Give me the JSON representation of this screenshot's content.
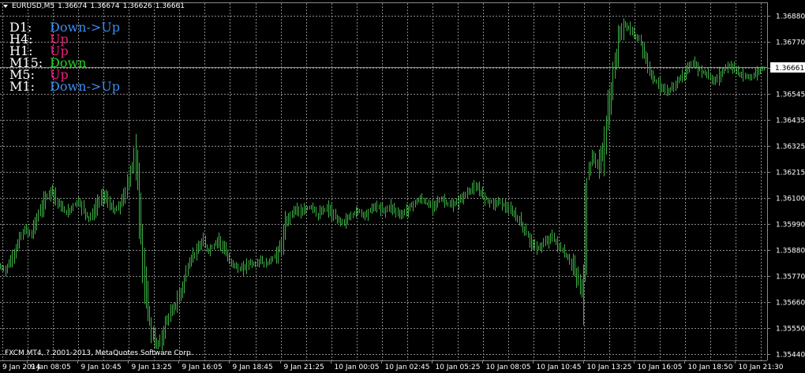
{
  "header": {
    "symbol": "EURUSD,M5",
    "ohlc": [
      "1.36674",
      "1.36674",
      "1.36626",
      "1.36661"
    ]
  },
  "indicator": {
    "rows": [
      {
        "tf": "D1:",
        "trend": "Down->Up",
        "color": "#3B8CF0"
      },
      {
        "tf": "H4:",
        "trend": "Up",
        "color": "#E8207A"
      },
      {
        "tf": "H1:",
        "trend": "Up",
        "color": "#E8207A"
      },
      {
        "tf": "M15:",
        "trend": "Down",
        "color": "#22D222"
      },
      {
        "tf": "M5:",
        "trend": "Up",
        "color": "#E8207A"
      },
      {
        "tf": "M1:",
        "trend": "Down->Up",
        "color": "#3B8CF0"
      }
    ]
  },
  "copyright": "FXCM MT4, ? 2001-2013, MetaQuotes Software Corp.",
  "colors": {
    "background": "#000000",
    "grid": "#8A8A8A",
    "bars": "#3CB043",
    "bid_line": "#7D8BA8",
    "text": "#FFFFFF"
  },
  "chart_data": {
    "type": "line",
    "price_axis_labels": [
      "1.36880",
      "1.36770",
      "1.36661",
      "1.36545",
      "1.36435",
      "1.36325",
      "1.36215",
      "1.36100",
      "1.35990",
      "1.35880",
      "1.35770",
      "1.35660",
      "1.35550",
      "1.35440"
    ],
    "current_price": "1.36661",
    "ylim": [
      1.3544,
      1.3688
    ],
    "time_axis_labels": [
      "9 Jan 2014",
      "9 Jan 08:05",
      "9 Jan 10:45",
      "9 Jan 13:25",
      "9 Jan 16:05",
      "9 Jan 18:45",
      "9 Jan 21:25",
      "10 Jan 00:05",
      "10 Jan 02:45",
      "10 Jan 05:25",
      "10 Jan 08:05",
      "10 Jan 10:45",
      "10 Jan 13:25",
      "10 Jan 16:05",
      "10 Jan 18:50",
      "10 Jan 21:30"
    ],
    "series": [
      {
        "x_start": 0,
        "values": [
          1.3581,
          1.358,
          1.3583,
          1.3588,
          1.3594,
          1.3597,
          1.3595,
          1.3601,
          1.3606,
          1.3611,
          1.3614,
          1.3609,
          1.3606,
          1.3604,
          1.3607,
          1.3609,
          1.3606,
          1.3602,
          1.3604,
          1.3609,
          1.3612,
          1.3608,
          1.3605,
          1.3607,
          1.3612,
          1.362,
          1.363,
          1.36,
          1.357,
          1.3555,
          1.3548,
          1.355,
          1.3558,
          1.3562,
          1.3566,
          1.3572,
          1.358,
          1.3586,
          1.3588,
          1.3592,
          1.3588,
          1.359,
          1.3593,
          1.3589,
          1.3584,
          1.3582,
          1.358,
          1.3581,
          1.3583,
          1.3582,
          1.3584,
          1.3582,
          1.3584,
          1.3586,
          1.359,
          1.36,
          1.3604,
          1.3606,
          1.3604,
          1.3606,
          1.3607,
          1.3603,
          1.3605,
          1.3606,
          1.3603,
          1.3601,
          1.36,
          1.3602,
          1.3604,
          1.3605,
          1.3603,
          1.3605,
          1.3607,
          1.3606,
          1.3605,
          1.3607,
          1.3605,
          1.3603,
          1.3605,
          1.3607,
          1.3609,
          1.361,
          1.3608,
          1.3607,
          1.3609,
          1.361,
          1.3608,
          1.3607,
          1.3609,
          1.3611,
          1.3613,
          1.3615,
          1.3614,
          1.3611,
          1.3609,
          1.3608,
          1.3609,
          1.3607,
          1.3605,
          1.3603,
          1.36,
          1.3596,
          1.3592,
          1.3589,
          1.359,
          1.3592,
          1.3594,
          1.3591,
          1.3588,
          1.3585,
          1.3582,
          1.3576,
          1.357,
          1.3622,
          1.3628,
          1.3624,
          1.3632,
          1.365,
          1.3665,
          1.368,
          1.3684,
          1.3682,
          1.3679,
          1.3678,
          1.367,
          1.3664,
          1.366,
          1.3658,
          1.3655,
          1.3657,
          1.366,
          1.3662,
          1.3665,
          1.3668,
          1.3666,
          1.3664,
          1.3663,
          1.366,
          1.3662,
          1.3665,
          1.3667,
          1.3666,
          1.3663,
          1.3662,
          1.3662,
          1.3663,
          1.3665,
          1.3666
        ]
      }
    ]
  }
}
